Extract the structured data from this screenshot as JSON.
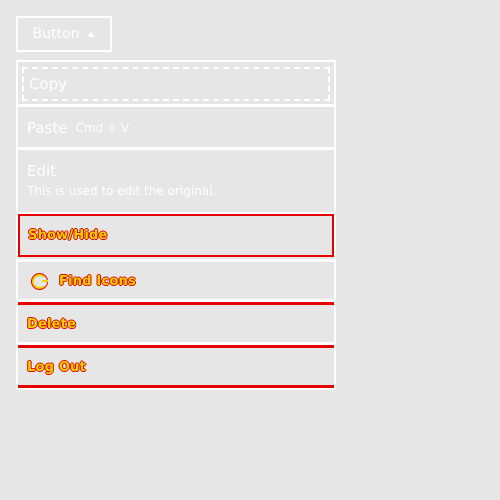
{
  "trigger": {
    "label": "Button"
  },
  "menu": {
    "copy": {
      "label": "Copy"
    },
    "paste": {
      "label": "Paste",
      "shortcut": "Cmd + V"
    },
    "edit": {
      "label": "Edit",
      "description": "This is used to edit the original."
    },
    "show_hide": {
      "label": "Show/Hide"
    },
    "find_icons": {
      "label": "Find Icons"
    },
    "delete": {
      "label": "Delete"
    },
    "log_out": {
      "label": "Log Out"
    }
  },
  "colors": {
    "background": "#e6e6e6",
    "foreground": "#ffffff",
    "highlight_red": "#e60000",
    "highlight_yellow": "#e8d400"
  }
}
